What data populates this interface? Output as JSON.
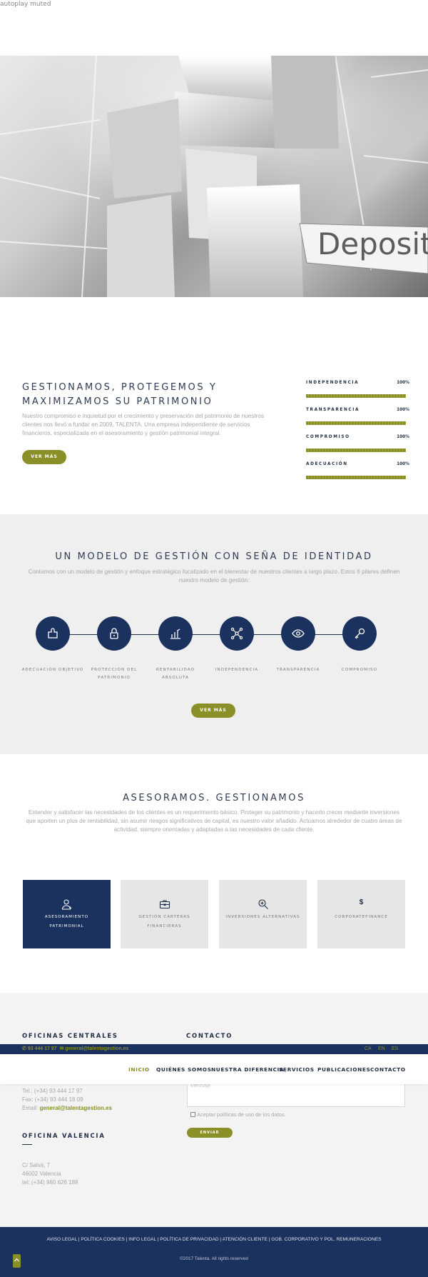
{
  "top": {
    "autoplay_note": "autoplay muted"
  },
  "hero": {
    "sign_text": "Deposito"
  },
  "intro": {
    "title": "GESTIONAMOS, PROTEGEMOS Y MAXIMIZAMOS SU PATRIMONIO",
    "text": "Nuestro compromiso e inquietud por el crecimiento y preservación del patrimonio de nuestros clientes nos llevó a fundar en 2009, TALENTA. Una empresa independiente de servicios financieros, especializada en el asesoramiento y gestión patrimonial integral.",
    "button": "VER MÁS",
    "bars": [
      {
        "label": "INDEPENDENCIA",
        "value_label": "100%",
        "value": 100
      },
      {
        "label": "TRANSPARENCIA",
        "value_label": "100%",
        "value": 100
      },
      {
        "label": "COMPROMISO",
        "value_label": "100%",
        "value": 100
      },
      {
        "label": "ADECUACIÓN",
        "value_label": "100%",
        "value": 100
      }
    ]
  },
  "model": {
    "title": "UN MODELO DE GESTIÓN CON SEÑA DE IDENTIDAD",
    "subtitle": "Contamos con un modelo de gestión y enfoque estratégico focalizado en el bienestar de nuestros clientes a largo plazo. Estos 6 pilares definen nuestro modelo de gestión:",
    "pillars": [
      {
        "label": "ADECUACIÓN OBJETIVO",
        "icon": "puzzle-icon"
      },
      {
        "label": "PROTECCIÓN DEL PATRIMONIO",
        "icon": "lock-icon"
      },
      {
        "label": "RENTABILIDAD ABSOLUTA",
        "icon": "bar-chart-icon"
      },
      {
        "label": "INDEPENDENCIA",
        "icon": "network-icon"
      },
      {
        "label": "TRANSPARENCIA",
        "icon": "eye-icon"
      },
      {
        "label": "COMPROMISO",
        "icon": "key-icon"
      }
    ],
    "button": "VER MÁS"
  },
  "services": {
    "title": "ASESORAMOS. GESTIONAMOS",
    "subtitle": "Entender y satisfacer las necesidades de los clientes es un requerimiento básico. Proteger su patrimonio y hacerlo crecer mediante inversiones que aporten un plus de rentabilidad, sin asumir riesgos significativos de capital, es nuestro valor añadido. Actuamos alrededor de cuatro áreas de actividad, siempre orientadas y adaptadas a las necesidades de cada cliente.",
    "cards": [
      {
        "label": "ASESORAMIENTO PATRIMONIAL",
        "icon": "advisor-icon"
      },
      {
        "label": "GESTIÓN CARTERAS FINANCIERAS",
        "icon": "briefcase-icon"
      },
      {
        "label": "INVERSIONES ALTERNATIVAS",
        "icon": "magnifier-plus-icon"
      },
      {
        "label": "CORPORATEFINANCE",
        "icon": "dollar-icon",
        "symbol": "$"
      }
    ]
  },
  "offices": {
    "central_heading": "OFICINAS CENTRALES",
    "central_lines": [
      "Tel.: (+34) 93 444 17 97",
      "Fax: (+34) 93 444 18 09"
    ],
    "email_label": "Email: ",
    "email": "general@talentagestion.es",
    "valencia_heading": "OFICINA VALENCIA",
    "valencia_lines": [
      "C/ Salvá, 7",
      "46002 Valencia",
      "tel: (+34) 960 626 188"
    ]
  },
  "contact": {
    "heading": "CONTACTO",
    "message_placeholder": "Mensaje",
    "accept_label": "Aceptar políticas de uso de los datos.",
    "send_button": "ENVIAR"
  },
  "topbar": {
    "phone": "93 444 17 97",
    "email": "general@talentagestion.es",
    "languages": [
      "CA",
      "EN",
      "ES"
    ]
  },
  "nav": {
    "items": [
      "INICIO",
      "QUIÉNES SOMOS",
      "NUESTRA DIFERENCIA",
      "SERVICIOS",
      "PUBLICACIONES",
      "CONTACTO"
    ],
    "active": "INICIO"
  },
  "footer": {
    "links": "AVISO LEGAL | POLÍTICA COOKIES | INFO LEGAL | POLÍTICA DE PRIVACIDAD | ATENCIÓN CLIENTE | GOB. CORPORATIVO Y POL. REMUNERACIONES",
    "copyright": "©2017 Talenta. All rights reserved"
  },
  "colors": {
    "navy": "#1b315e",
    "olive": "#8a8f28",
    "grey_bg": "#efefef"
  }
}
